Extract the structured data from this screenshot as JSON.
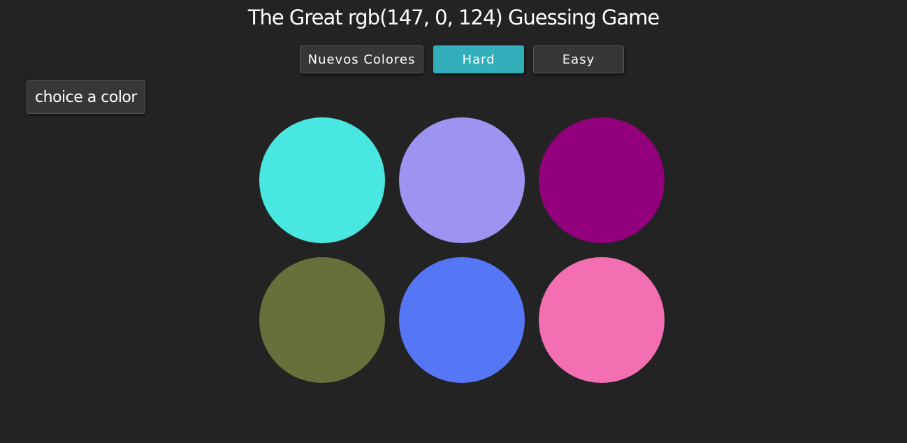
{
  "header": {
    "title": "The Great rgb(147, 0, 124) Guessing Game"
  },
  "controls": {
    "new_colors_label": "Nuevos Colores",
    "hard_label": "Hard",
    "easy_label": "Easy",
    "selected_mode": "Hard",
    "accent_color": "#31aeb9"
  },
  "message": {
    "label": "choice a color"
  },
  "squares": [
    {
      "color": "#48e8e0"
    },
    {
      "color": "#9d93f0"
    },
    {
      "color": "#93007c"
    },
    {
      "color": "#676f3b"
    },
    {
      "color": "#5577f6"
    },
    {
      "color": "#f46fb2"
    }
  ]
}
